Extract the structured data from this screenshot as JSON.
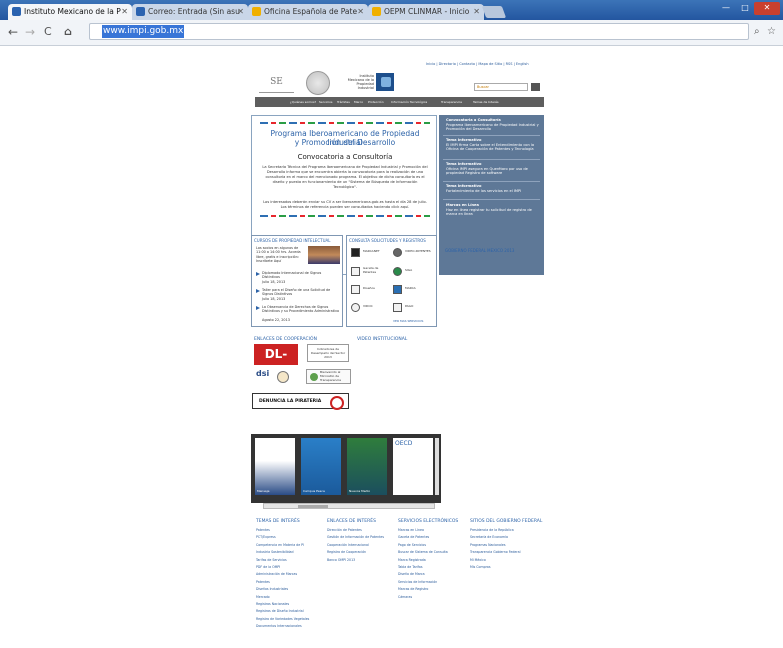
{
  "browser": {
    "tabs": [
      {
        "title": "Instituto Mexicano de la P",
        "active": true
      },
      {
        "title": "Correo: Entrada (Sin asu",
        "active": false
      },
      {
        "title": "Oficina Española de Pate",
        "active": false
      },
      {
        "title": "OEPM CLINMAR - Inicio",
        "active": false
      }
    ],
    "url": "www.impi.gob.mx",
    "window_controls": {
      "minimize": "—",
      "maximize": "□",
      "close": "✕"
    }
  },
  "site": {
    "top_links": "Inicio | Directorio | Contacto | Mapa de Sitio | RSS | English",
    "logo_se": "SE",
    "impi_name": "Instituto Mexicano de la Propiedad Industrial",
    "search_placeholder": "Buscar",
    "nav": [
      "¿Quiénes somos?",
      "Servicios",
      "Trámites",
      "Marco",
      "Protección",
      "Información Tecnológica",
      "Transparencia",
      "Temas de Interés"
    ],
    "banner": {
      "title1": "Programa Iberoamericano de Propiedad Industrial",
      "title2": "y Promoción del Desarrollo",
      "subtitle": "Convocatoria a Consultoría",
      "p1": "La Secretaría Técnica del Programa Iberoamericano de Propiedad Industrial y Promoción del Desarrollo informa que se encuentra abierta la convocatoria para la realización de una consultoría en el marco del mencionado programa. El objetivo de dicha consultoría es el diseño y puesta en funcionamiento de un \"Sistema de Búsqueda de Información Tecnológica\".",
      "p2": "Los interesados deberán enviar su CV a ser iberoamericana.gob.es hasta el día 28 de julio. Los términos de referencia pueden ser consultados haciendo click aquí."
    },
    "sidebar": [
      {
        "title": "Convocatoria a Consultoría",
        "text": "Programa Iberoamericano de Propiedad Industrial y Promoción del Desarrollo"
      },
      {
        "title": "Tema Informativo",
        "text": "El IMPI firma Carta sobre el Entendimiento con la Oficina de Cooperación de Patentes y Tecnología"
      },
      {
        "title": "Tema Informativo",
        "text": "Oficina IMPI asegura en Querétaro por uso de propiedad Registro de software"
      },
      {
        "title": "Tema Informativo",
        "text": "Fortalecimiento de los servicios en el IMPI"
      },
      {
        "title": "Marcas en Línea",
        "text": "Haz en línea registrar tu solicitud de registro de marca en línea"
      }
    ],
    "cursos": {
      "header": "CURSOS DE PROPIEDAD INTELECTUAL",
      "intro": "Los socios en algunos de 11:00 a 14:00 hrs. Acceda libre, gratis e inscripción: Inscríbete Aquí",
      "items": [
        {
          "title": "Diplomado Internacional de Signos Distintivos",
          "date": "Julio 18, 2013"
        },
        {
          "title": "Taller para el Diseño de una Solicitud de Signos Distintivos",
          "date": "Julio 18, 2013"
        },
        {
          "title": "La Observancia de Derechos de Signos Distintivos y su Procedimiento Administrativo",
          "date": "Agosto 22, 2013"
        }
      ]
    },
    "consulta": {
      "header": "CONSULTA SOLICITUDES Y REGISTROS",
      "items": [
        "MARCANET",
        "VIDEO-PATENTES",
        "Gaceta de Patentes",
        "SIGA",
        "Diseños",
        "MARCA",
        "VIDOC",
        "PAGO",
        "TECNOLOGÍAS",
        "MIS SERVICIOS ALSIO"
      ],
      "more": "VER MAS SERVICIOS"
    },
    "gobierno": "GOBIERNO FEDERAL MEXICO 2013",
    "enlaces_header": "ENLACES DE COOPERACIÓN",
    "video_header": "VIDEO INSTITUCIONAL",
    "dl101": "DL-101S",
    "indicadores": "Indicadores de Desempeño del Sector 2013",
    "dsi": "dsi",
    "bienvenido": "Bienvenido al Micrositio de Transparencia",
    "pirateria": "DENUNCIA LA PIRATERIA",
    "carousel": [
      "Mensaje",
      "Campus Pesca",
      "Nuevos Medio",
      "OECD"
    ],
    "footer": [
      {
        "header": "TEMAS DE INTERÉS",
        "links": [
          "Patentes",
          "PCT/Express",
          "Competencia en Materia de PI",
          "Industria Sostenibilidad",
          "Tarifas de Servicios",
          "PDF de la OMPI",
          "Administración de Marcas",
          "Patentes",
          "Diseños Industriales",
          "Mercado",
          "Registros Nacionales",
          "Registros de Diseño Industrial",
          "Registro de Variedades Vegetales",
          "Documentos Internacionales"
        ]
      },
      {
        "header": "ENLACES DE INTERÉS",
        "links": [
          "Dirección de Patentes",
          "Gestión de Información de Patentes",
          "Cooperación Internacional",
          "Registro de Cooperación",
          "Banco OMPI 2013"
        ]
      },
      {
        "header": "SERVICIOS ELECTRÓNICOS",
        "links": [
          "Marcas en Línea",
          "Gaceta de Patentes",
          "Pago de Servicios",
          "Buscar de Sistema de Consulta",
          "Marca Registrada",
          "Tabla de Tarifas",
          "Diseño de Marca",
          "Servicios de Información",
          "Marcas de Registro",
          "Cámaras"
        ]
      },
      {
        "header": "SITIOS DEL GOBIERNO FEDERAL",
        "links": [
          "Presidencia de la República",
          "Secretaría de Economía",
          "Programas Nacionales",
          "Transparencia Gobierno Federal",
          "Mi México",
          "Mis Compras"
        ]
      }
    ]
  }
}
